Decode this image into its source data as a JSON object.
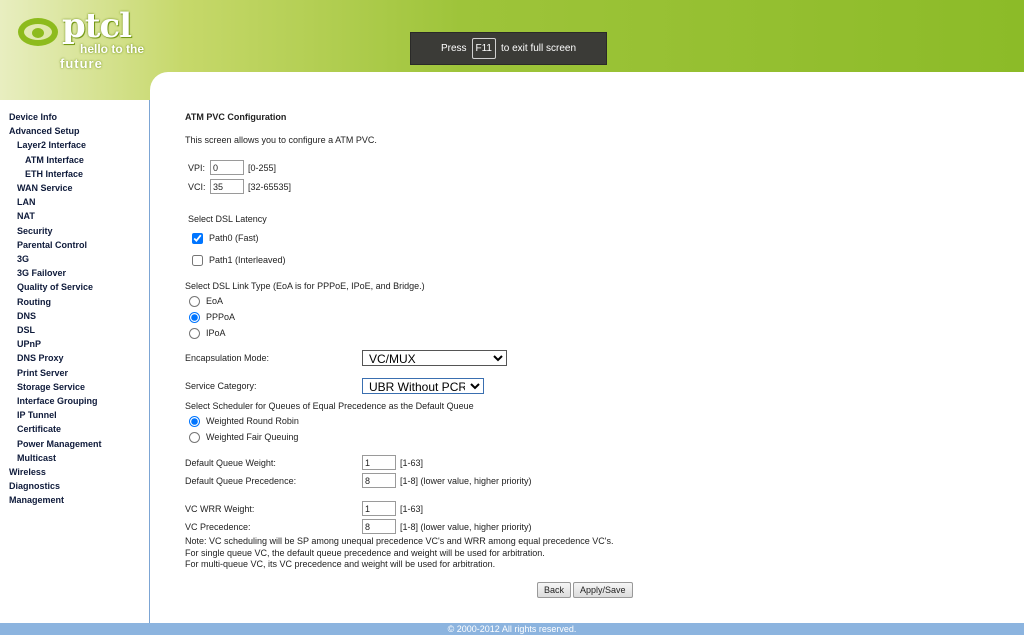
{
  "header": {
    "logo_word": "ptcl",
    "logo_tagline_1": "hello to the",
    "logo_tagline_2": "future",
    "banner_press": "Press",
    "banner_key": "F11",
    "banner_rest": "to exit full screen"
  },
  "sidebar": {
    "items": [
      {
        "label": "Device Info",
        "level": 0
      },
      {
        "label": "Advanced Setup",
        "level": 0
      },
      {
        "label": "Layer2 Interface",
        "level": 1
      },
      {
        "label": "ATM Interface",
        "level": 2
      },
      {
        "label": "ETH Interface",
        "level": 2
      },
      {
        "label": "WAN Service",
        "level": 1
      },
      {
        "label": "LAN",
        "level": 1
      },
      {
        "label": "NAT",
        "level": 1
      },
      {
        "label": "Security",
        "level": 1
      },
      {
        "label": "Parental Control",
        "level": 1
      },
      {
        "label": "3G",
        "level": 1
      },
      {
        "label": "3G Failover",
        "level": 1
      },
      {
        "label": "Quality of Service",
        "level": 1
      },
      {
        "label": "Routing",
        "level": 1
      },
      {
        "label": "DNS",
        "level": 1
      },
      {
        "label": "DSL",
        "level": 1
      },
      {
        "label": "UPnP",
        "level": 1
      },
      {
        "label": "DNS Proxy",
        "level": 1
      },
      {
        "label": "Print Server",
        "level": 1
      },
      {
        "label": "Storage Service",
        "level": 1
      },
      {
        "label": "Interface Grouping",
        "level": 1
      },
      {
        "label": "IP Tunnel",
        "level": 1
      },
      {
        "label": "Certificate",
        "level": 1
      },
      {
        "label": "Power Management",
        "level": 1
      },
      {
        "label": "Multicast",
        "level": 1
      },
      {
        "label": "Wireless",
        "level": 0
      },
      {
        "label": "Diagnostics",
        "level": 0
      },
      {
        "label": "Management",
        "level": 0
      }
    ]
  },
  "main": {
    "title": "ATM PVC Configuration",
    "intro": "This screen allows you to configure a ATM PVC.",
    "vpi": {
      "label": "VPI:",
      "value": "0",
      "range": "[0-255]"
    },
    "vci": {
      "label": "VCI:",
      "value": "35",
      "range": "[32-65535]"
    },
    "latency": {
      "heading": "Select DSL Latency",
      "path0": "Path0 (Fast)",
      "path1": "Path1 (Interleaved)"
    },
    "link_type": {
      "heading": "Select DSL Link Type (EoA is for PPPoE, IPoE, and Bridge.)",
      "eoa": "EoA",
      "pppoa": "PPPoA",
      "ipoa": "IPoA"
    },
    "encapsulation": {
      "label": "Encapsulation Mode:",
      "value": "VC/MUX"
    },
    "service_category": {
      "label": "Service Category:",
      "value": "UBR Without PCR"
    },
    "scheduler": {
      "heading": "Select Scheduler for Queues of Equal Precedence as the Default Queue",
      "wrr": "Weighted Round Robin",
      "wfq": "Weighted Fair Queuing"
    },
    "default_queue_weight": {
      "label": "Default Queue Weight:",
      "value": "1",
      "range": "[1-63]"
    },
    "default_queue_precedence": {
      "label": "Default Queue Precedence:",
      "value": "8",
      "range": "[1-8] (lower value, higher priority)"
    },
    "vc_wrr_weight": {
      "label": "VC WRR Weight:",
      "value": "1",
      "range": "[1-63]"
    },
    "vc_precedence": {
      "label": "VC Precedence:",
      "value": "8",
      "range": "[1-8] (lower value, higher priority)"
    },
    "note_1": "Note: VC scheduling will be SP among unequal precedence VC's and WRR among equal precedence VC's.",
    "note_2": "For single queue VC, the default queue precedence and weight will be used for arbitration.",
    "note_3": "For multi-queue VC, its VC precedence and weight will be used for arbitration.",
    "back_label": "Back",
    "apply_label": "Apply/Save"
  },
  "footer": {
    "copyright": "© 2000-2012 All rights reserved."
  },
  "colors": {
    "brand_green": "#8dbb1d",
    "footer_blue": "#8cb4df",
    "nav_text": "#0e1a3a"
  }
}
